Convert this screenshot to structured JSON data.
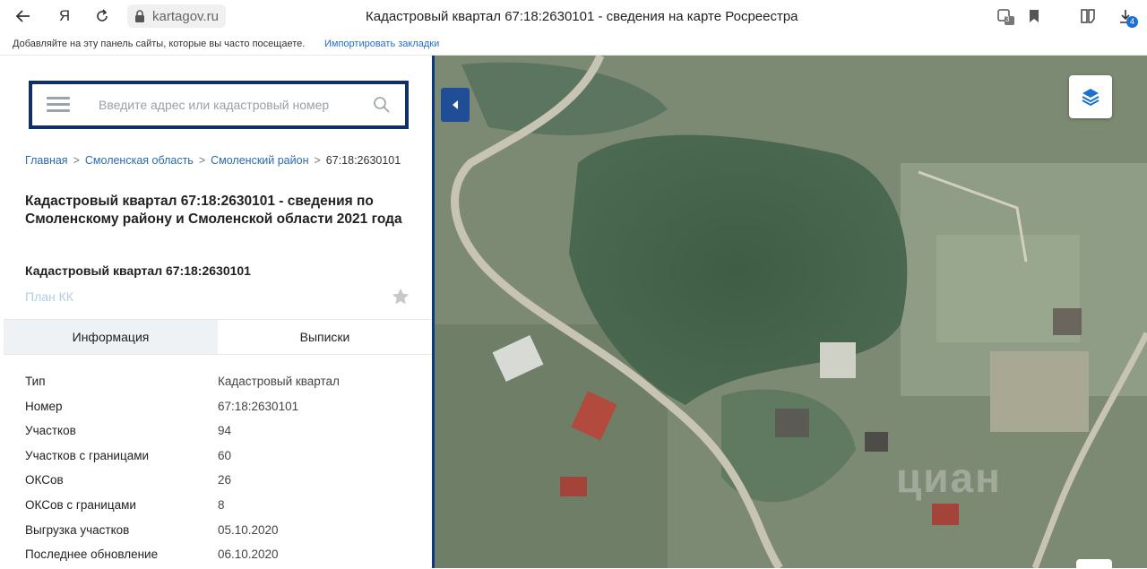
{
  "browser": {
    "url": "kartagov.ru",
    "title": "Кадастровый квартал 67:18:2630101 - сведения на карте Росреестра",
    "home_glyph": "Я",
    "collections_count": "3",
    "downloads_count": "4",
    "bookmarks_hint": "Добавляйте на эту панель сайты, которые вы часто посещаете.",
    "import_bookmarks": "Импортировать закладки"
  },
  "search": {
    "placeholder": "Введите адрес или кадастровый номер"
  },
  "breadcrumbs": [
    {
      "label": "Главная"
    },
    {
      "label": "Смоленская область"
    },
    {
      "label": "Смоленский район"
    },
    {
      "label": "67:18:2630101"
    }
  ],
  "page": {
    "heading": "Кадастровый квартал 67:18:2630101 - сведения по Смоленскому району и Смоленской области 2021 года",
    "subheading": "Кадастровый квартал 67:18:2630101",
    "plan_link": "План КК"
  },
  "tabs": [
    {
      "label": "Информация",
      "active": true
    },
    {
      "label": "Выписки",
      "active": false
    }
  ],
  "info": [
    {
      "key": "Тип",
      "value": "Кадастровый квартал"
    },
    {
      "key": "Номер",
      "value": "67:18:2630101"
    },
    {
      "key": "Участков",
      "value": "94"
    },
    {
      "key": "Участков с границами",
      "value": "60"
    },
    {
      "key": "ОКСов",
      "value": "26"
    },
    {
      "key": "ОКСов с границами",
      "value": "8"
    },
    {
      "key": "Выгрузка участков",
      "value": "05.10.2020"
    },
    {
      "key": "Последнее обновление",
      "value": "06.10.2020"
    }
  ],
  "map": {
    "watermark": "циан"
  },
  "colors": {
    "accent": "#1f4e96",
    "search_border": "#0f2f66",
    "link": "#2a6ab2"
  }
}
